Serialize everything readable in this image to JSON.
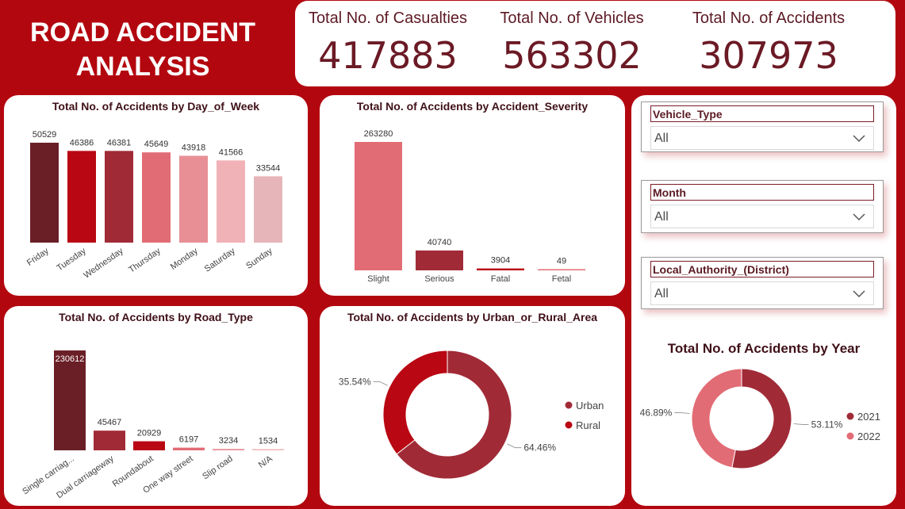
{
  "header": {
    "title": "ROAD ACCIDENT ANALYSIS"
  },
  "kpis": [
    {
      "label": "Total No. of Casualties",
      "value": "417883"
    },
    {
      "label": "Total No. of Vehicles",
      "value": "563302"
    },
    {
      "label": "Total No. of Accidents",
      "value": "307973"
    }
  ],
  "slicers": [
    {
      "label": "Vehicle_Type",
      "value": "All"
    },
    {
      "label": "Month",
      "value": "All"
    },
    {
      "label": "Local_Authority_(District)",
      "value": "All"
    }
  ],
  "colors": {
    "background": "#b3070f",
    "dark": "#6a1f27",
    "mid": "#9f2f3a",
    "red": "#b90813",
    "pink": "#e26c75",
    "light": "#f1b2b7"
  },
  "chart_data": [
    {
      "id": "day",
      "type": "bar",
      "title": "Total No. of Accidents by Day_of_Week",
      "categories": [
        "Friday",
        "Tuesday",
        "Wednesday",
        "Thursday",
        "Monday",
        "Saturday",
        "Sunday"
      ],
      "values": [
        50529,
        46386,
        46381,
        45649,
        43918,
        41566,
        33544
      ],
      "colors": [
        "#6a1f27",
        "#b90813",
        "#a02b37",
        "#e26c75",
        "#e88f96",
        "#f1b2b7",
        "#e6b5b9"
      ]
    },
    {
      "id": "severity",
      "type": "bar",
      "title": "Total No. of Accidents by Accident_Severity",
      "categories": [
        "Slight",
        "Serious",
        "Fatal",
        "Fetal"
      ],
      "values": [
        263280,
        40740,
        3904,
        49
      ],
      "colors": [
        "#e26c75",
        "#a02b37",
        "#b90813",
        "#e26c75"
      ]
    },
    {
      "id": "road",
      "type": "bar",
      "title": "Total No. of Accidents by Road_Type",
      "categories": [
        "Single carriag...",
        "Dual carriageway",
        "Roundabout",
        "One way street",
        "Slip road",
        "N/A"
      ],
      "values": [
        230612,
        45467,
        20929,
        6197,
        3234,
        1534
      ],
      "colors": [
        "#6a1f27",
        "#a02b37",
        "#b90813",
        "#e26c75",
        "#e88f96",
        "#f1b2b7"
      ]
    },
    {
      "id": "area",
      "type": "pie",
      "title": "Total No. of Accidents by Urban_or_Rural_Area",
      "series": [
        {
          "name": "Urban",
          "percent": 64.46,
          "label": "64.46%",
          "color": "#a02b37"
        },
        {
          "name": "Rural",
          "percent": 35.54,
          "label": "35.54%",
          "color": "#b90813"
        }
      ]
    },
    {
      "id": "year",
      "type": "pie",
      "title": "Total No. of Accidents by Year",
      "series": [
        {
          "name": "2021",
          "percent": 53.11,
          "label": "53.11%",
          "color": "#a02b37"
        },
        {
          "name": "2022",
          "percent": 46.89,
          "label": "46.89%",
          "color": "#e26c75"
        }
      ]
    }
  ]
}
